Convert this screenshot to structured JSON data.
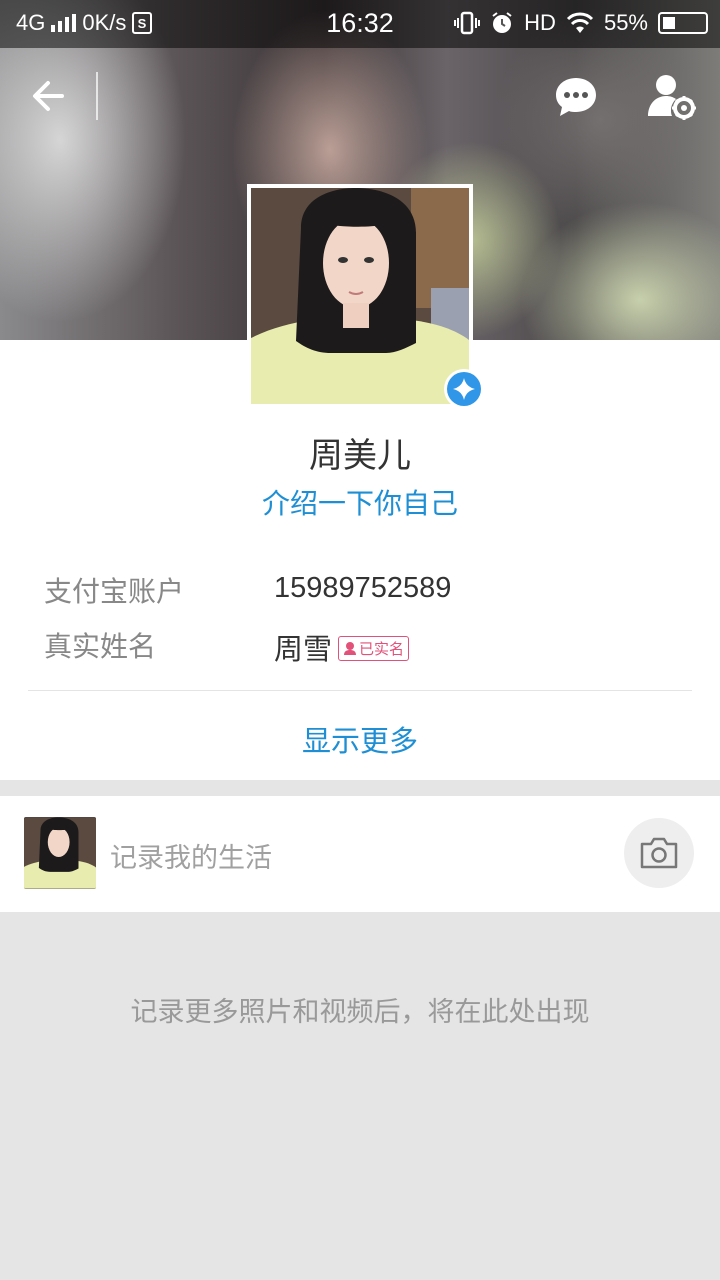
{
  "status_bar": {
    "network": "4G",
    "speed": "0K/s",
    "time": "16:32",
    "hd": "HD",
    "battery": "55%"
  },
  "nav": {
    "back_icon": "arrow-left-icon",
    "chat_icon": "chat-bubble-icon",
    "settings_icon": "user-settings-icon"
  },
  "profile": {
    "name": "周美儿",
    "intro_link": "介绍一下你自己",
    "verified_icon": "verified-star-icon"
  },
  "info_rows": [
    {
      "label": "支付宝账户",
      "value": "15989752589"
    },
    {
      "label": "真实姓名",
      "value": "周雪",
      "tag": "已实名"
    }
  ],
  "show_more": "显示更多",
  "post": {
    "placeholder": "记录我的生活",
    "camera_icon": "camera-icon"
  },
  "empty_message": "记录更多照片和视频后，将在此处出现",
  "colors": {
    "accent": "#1e8fd4",
    "tag": "#e2517a",
    "background": "#e5e5e5"
  }
}
